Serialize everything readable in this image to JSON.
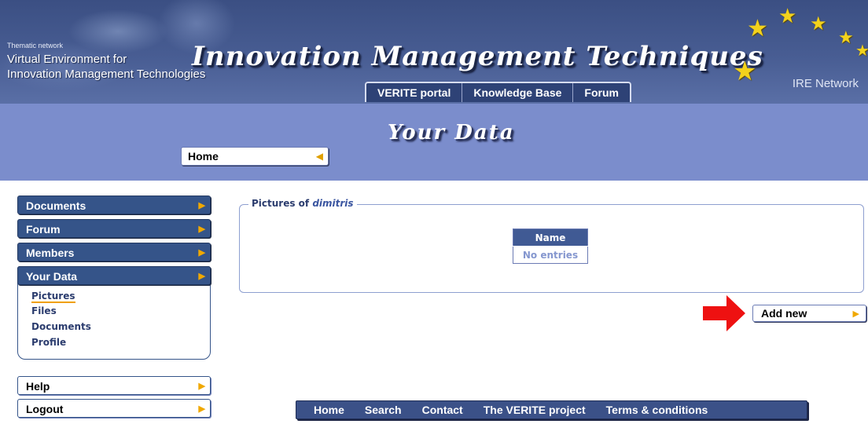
{
  "header": {
    "thematic": "Thematic network",
    "org_line1": "Virtual Environment for",
    "org_line2": "Innovation Management Technologies",
    "title": "Innovation Management Techniques",
    "network": "IRE Network",
    "tabs": [
      {
        "label": "VERITE portal"
      },
      {
        "label": "Knowledge Base"
      },
      {
        "label": "Forum"
      }
    ]
  },
  "section": {
    "title": "Your Data",
    "breadcrumb": "Home"
  },
  "sidebar": {
    "items": [
      {
        "label": "Documents"
      },
      {
        "label": "Forum"
      },
      {
        "label": "Members"
      },
      {
        "label": "Your Data"
      }
    ],
    "subitems": [
      {
        "label": "Pictures",
        "active": true
      },
      {
        "label": "Files"
      },
      {
        "label": "Documents"
      },
      {
        "label": "Profile"
      }
    ],
    "help": "Help",
    "logout": "Logout"
  },
  "main": {
    "legend_prefix": "Pictures of ",
    "legend_user": "dimitris",
    "table_header": "Name",
    "table_empty": "No entries",
    "add_new": "Add new"
  },
  "footer": {
    "links": [
      {
        "label": "Home"
      },
      {
        "label": "Search"
      },
      {
        "label": "Contact"
      },
      {
        "label": "The VERITE project"
      },
      {
        "label": "Terms & conditions"
      }
    ]
  },
  "colors": {
    "banner": "#485d93",
    "subbanner": "#7b8dcc",
    "nav_dark": "#355489",
    "accent_arrow": "#f0a800",
    "highlight_arrow": "#ee1111"
  }
}
